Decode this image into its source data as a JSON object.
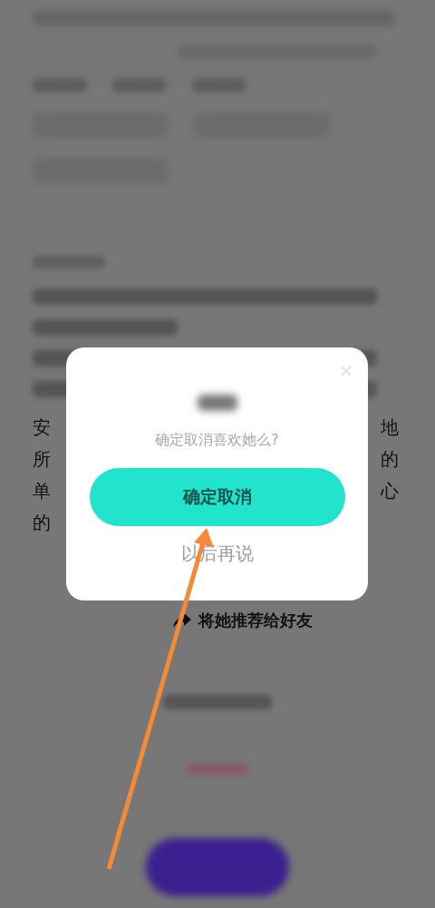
{
  "background": {
    "text_lines": [
      {
        "left": "安",
        "right": "地"
      },
      {
        "left": "所",
        "right": "的"
      },
      {
        "left": "单",
        "right": "心"
      },
      {
        "left": "的"
      }
    ],
    "share_link": "将她推荐给好友"
  },
  "dialog": {
    "message": "确定取消喜欢她么?",
    "confirm_button": "确定取消",
    "later_button": "以后再说"
  }
}
